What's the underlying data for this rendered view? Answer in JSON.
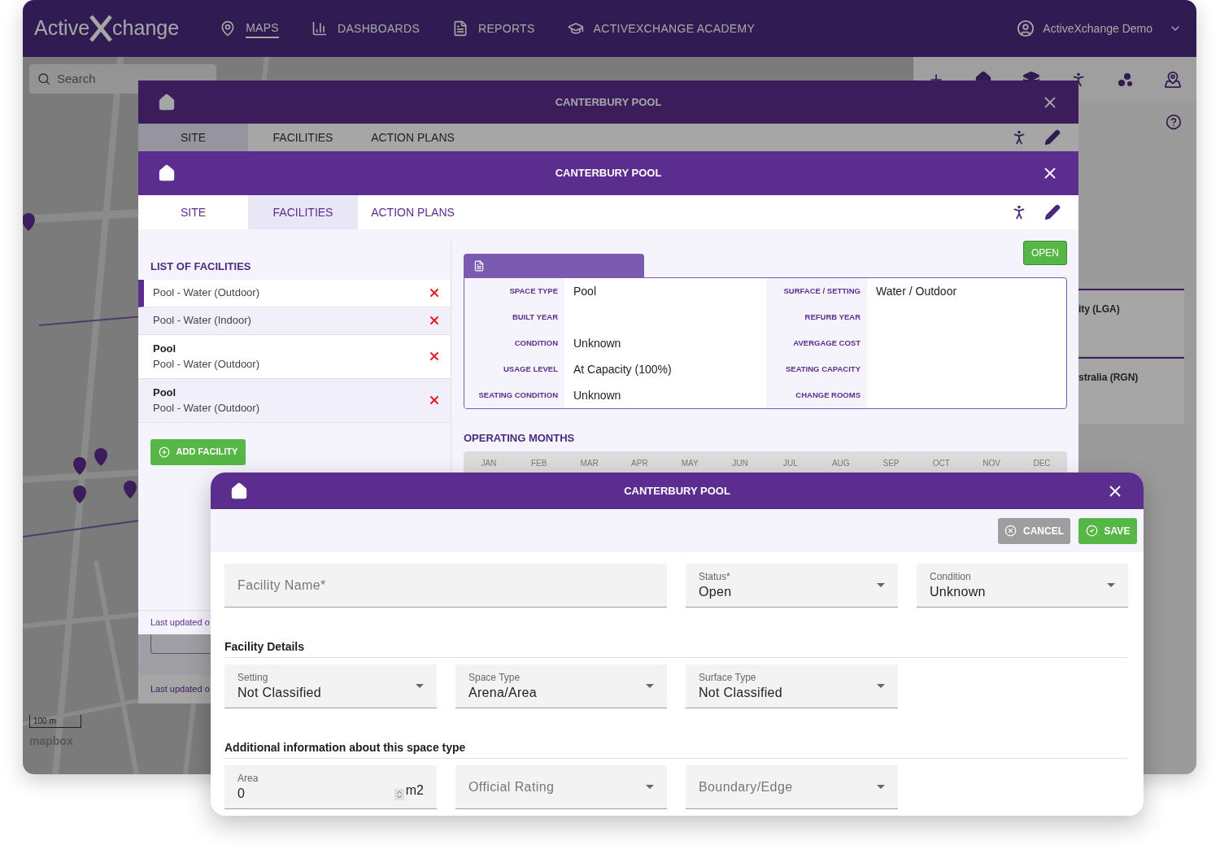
{
  "nav": {
    "logo": [
      "Active",
      "change"
    ],
    "items": [
      {
        "label": "MAPS",
        "selected": true
      },
      {
        "label": "DASHBOARDS",
        "selected": false
      },
      {
        "label": "REPORTS",
        "selected": false
      },
      {
        "label": "ACTIVEXCHANGE ACADEMY",
        "selected": false
      }
    ],
    "user": "ActiveXchange Demo"
  },
  "map": {
    "search_placeholder": "Search",
    "scale": "100 m",
    "attribution": "mapbox"
  },
  "side_panel": {
    "rows": [
      "ity (LGA)",
      "stralia (RGN)"
    ]
  },
  "back_dialog": {
    "title": "CANTERBURY POOL",
    "tabs": [
      {
        "label": "SITE",
        "selected": true
      },
      {
        "label": "FACILITIES",
        "selected": false
      },
      {
        "label": "ACTION PLANS",
        "selected": false
      }
    ],
    "footer": "Last updated o"
  },
  "facility_dialog": {
    "title": "CANTERBURY POOL",
    "tabs": [
      {
        "label": "SITE",
        "selected": false
      },
      {
        "label": "FACILITIES",
        "selected": true
      },
      {
        "label": "ACTION PLANS",
        "selected": false
      }
    ],
    "list_title": "LIST OF FACILITIES",
    "facilities": [
      {
        "type": "Pool - Water (Outdoor)",
        "selected": true
      },
      {
        "type": "Pool - Water (Indoor)",
        "selected": false
      },
      {
        "name": "Pool",
        "type": "Pool - Water (Outdoor)",
        "selected": false
      },
      {
        "name": "Pool",
        "type": "Pool - Water (Outdoor)",
        "selected": false
      }
    ],
    "add_button": "ADD FACILITY",
    "status": "OPEN",
    "fields": [
      {
        "label": "SPACE TYPE",
        "value": "Pool"
      },
      {
        "label": "SURFACE / SETTING",
        "value": "Water / Outdoor"
      },
      {
        "label": "BUILT YEAR"
      },
      {
        "label": "REFURB YEAR"
      },
      {
        "label": "CONDITION",
        "value": "Unknown"
      },
      {
        "label": "AVERGAGE COST"
      },
      {
        "label": "USAGE LEVEL",
        "value": "At Capacity (100%)"
      },
      {
        "label": "SEATING CAPACITY"
      },
      {
        "label": "SEATING CONDITION",
        "value": "Unknown"
      },
      {
        "label": "CHANGE ROOMS"
      }
    ],
    "months_title": "OPERATING MONTHS",
    "months": [
      "JAN",
      "FEB",
      "MAR",
      "APR",
      "MAY",
      "JUN",
      "JUL",
      "AUG",
      "SEP",
      "OCT",
      "NOV",
      "DEC"
    ],
    "footer": "Last updated o"
  },
  "edit_dialog": {
    "title": "CANTERBURY POOL",
    "cancel": "CANCEL",
    "save": "SAVE",
    "top_fields": [
      {
        "kind": "text",
        "placeholder": "Facility Name*"
      },
      {
        "kind": "select",
        "label": "Status*",
        "value": "Open"
      },
      {
        "kind": "select",
        "label": "Condition",
        "value": "Unknown"
      }
    ],
    "sections": [
      {
        "title": "Facility Details",
        "fields": [
          {
            "kind": "select",
            "label": "Setting",
            "value": "Not Classified"
          },
          {
            "kind": "select",
            "label": "Space Type",
            "value": "Arena/Area"
          },
          {
            "kind": "select",
            "label": "Surface Type",
            "value": "Not Classified"
          }
        ]
      },
      {
        "title": "Additional information about this space type",
        "fields": [
          {
            "kind": "number",
            "label": "Area",
            "value": "0",
            "unit": "m2"
          },
          {
            "kind": "select",
            "placeholder": "Official Rating"
          },
          {
            "kind": "select",
            "placeholder": "Boundary/Edge"
          }
        ]
      }
    ]
  }
}
